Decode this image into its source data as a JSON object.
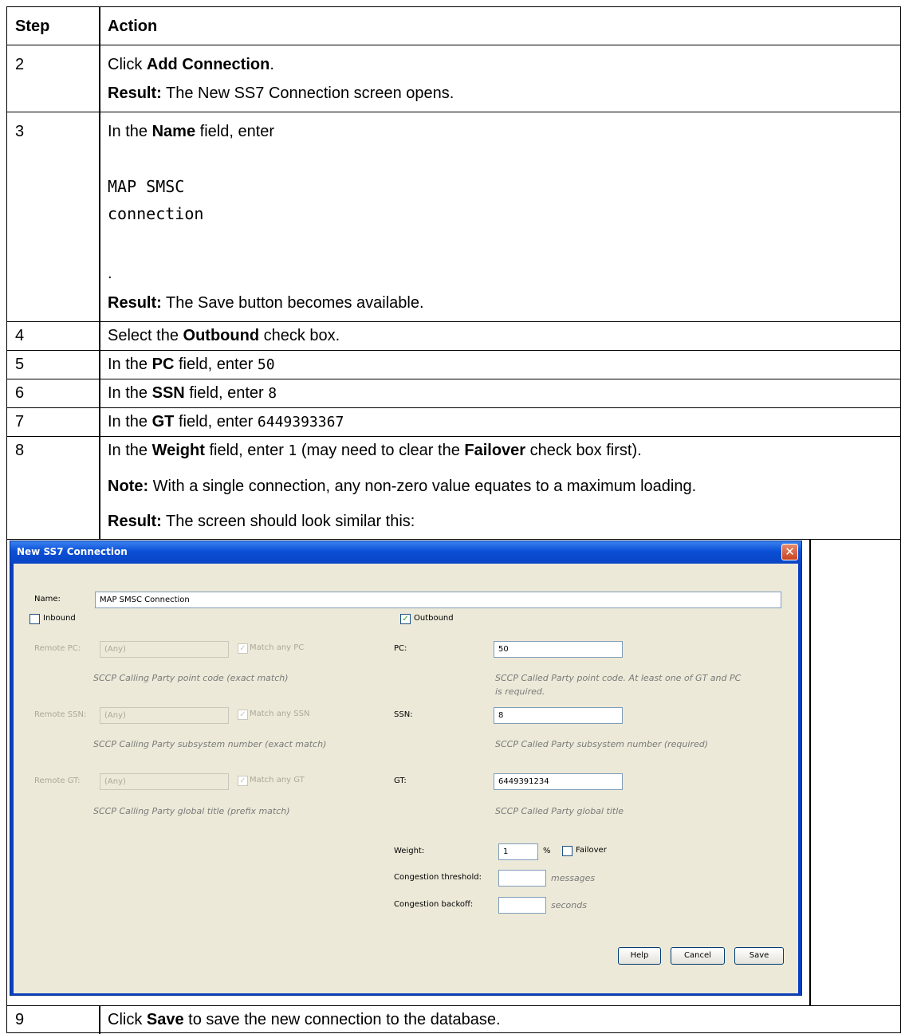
{
  "header": {
    "step": "Step",
    "action": "Action"
  },
  "rows": {
    "r2": {
      "step": "2",
      "a_prefix": "Click ",
      "a_bold": "Add Connection",
      "a_suffix": ".",
      "result_label": "Result:",
      "result_text": " The New SS7 Connection screen opens."
    },
    "r3": {
      "step": "3",
      "a_prefix": "In the ",
      "a_bold": "Name",
      "a_suffix": " field, enter",
      "code_line1": "MAP SMSC",
      "code_line2": "connection",
      "dot": ".",
      "result_label": "Result:",
      "result_text": " The Save button becomes available."
    },
    "r4": {
      "step": "4",
      "a_prefix": "Select the ",
      "a_bold": "Outbound",
      "a_suffix": " check box."
    },
    "r5": {
      "step": "5",
      "a_prefix": "In the ",
      "a_bold": "PC",
      "a_suffix": " field, enter ",
      "code": "50"
    },
    "r6": {
      "step": "6",
      "a_prefix": "In the ",
      "a_bold": "SSN",
      "a_suffix": " field, enter ",
      "code": "8"
    },
    "r7": {
      "step": "7",
      "a_prefix": "In the ",
      "a_bold": "GT",
      "a_suffix": " field, enter ",
      "code": "6449393367"
    },
    "r8": {
      "step": "8",
      "a_prefix": "In the ",
      "a_bold": "Weight",
      "a_mid": " field, enter ",
      "code": "1",
      "a_mid2": " (may need to clear the ",
      "a_bold2": "Failover",
      "a_suffix": " check box first).",
      "note_label": "Note:",
      "note_text": " With a single connection, any non-zero value equates to a maximum loading.",
      "result_label": "Result:",
      "result_text": " The screen should look similar this:"
    },
    "r9": {
      "step": "9",
      "a_prefix": "Click ",
      "a_bold": "Save",
      "a_suffix": " to save the new connection to the database."
    }
  },
  "dialog": {
    "title": "New SS7 Connection",
    "close_glyph": "✕",
    "name_label": "Name:",
    "name_value": "MAP SMSC Connection",
    "inbound_label": "Inbound",
    "inbound_checked": false,
    "outbound_label": "Outbound",
    "outbound_checked": true,
    "check_glyph": "✓",
    "remote_pc_label": "Remote PC:",
    "remote_pc_value": "(Any)",
    "match_pc_label": "Match any PC",
    "remote_pc_hint": "SCCP Calling Party point code (exact match)",
    "pc_label": "PC:",
    "pc_value": "50",
    "pc_hint_1": "SCCP Called Party point code. At least one of GT and PC",
    "pc_hint_2": "is required.",
    "remote_ssn_label": "Remote SSN:",
    "remote_ssn_value": "(Any)",
    "match_ssn_label": "Match any SSN",
    "remote_ssn_hint": "SCCP Calling Party subsystem number (exact match)",
    "ssn_label": "SSN:",
    "ssn_value": "8",
    "ssn_hint": "SCCP Called Party subsystem number (required)",
    "remote_gt_label": "Remote GT:",
    "remote_gt_value": "(Any)",
    "match_gt_label": "Match any GT",
    "remote_gt_hint": "SCCP Calling Party global title (prefix match)",
    "gt_label": "GT:",
    "gt_value": "6449391234",
    "gt_hint": "SCCP Called Party global title",
    "weight_label": "Weight:",
    "weight_value": "1",
    "percent": "%",
    "failover_label": "Failover",
    "failover_checked": false,
    "cong_threshold_label": "Congestion threshold:",
    "cong_threshold_value": "",
    "messages_unit": "messages",
    "cong_backoff_label": "Congestion backoff:",
    "cong_backoff_value": "",
    "seconds_unit": "seconds",
    "help_button": "Help",
    "cancel_button": "Cancel",
    "save_button": "Save"
  }
}
